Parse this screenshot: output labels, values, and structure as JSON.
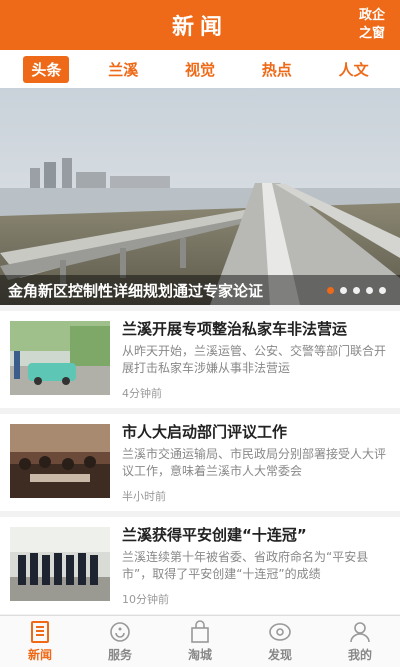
{
  "header": {
    "title": "新闻",
    "right_label": "政企之窗"
  },
  "tabs": [
    {
      "label": "头条",
      "active": true
    },
    {
      "label": "兰溪",
      "active": false
    },
    {
      "label": "视觉",
      "active": false
    },
    {
      "label": "热点",
      "active": false
    },
    {
      "label": "人文",
      "active": false
    }
  ],
  "banner": {
    "caption": "金角新区控制性详细规划通过专家论证",
    "dots": 5,
    "active_dot": 0
  },
  "news": [
    {
      "title": "兰溪开展专项整治私家车非法营运",
      "summary": "从昨天开始，兰溪运管、公安、交警等部门联合开展打击私家车涉嫌从事非法营运",
      "time": "4分钟前"
    },
    {
      "title": "市人大启动部门评议工作",
      "summary": "兰溪市交通运输局、市民政局分别部署接受人大评议工作，意味着兰溪市人大常委会",
      "time": "半小时前"
    },
    {
      "title": "兰溪获得平安创建“十连冠”",
      "summary": "兰溪连续第十年被省委、省政府命名为“平安县市”，取得了平安创建“十连冠”的成绩",
      "time": "10分钟前"
    }
  ],
  "bottom_nav": [
    {
      "label": "新闻",
      "icon": "news-icon",
      "active": true
    },
    {
      "label": "服务",
      "icon": "service-icon",
      "active": false
    },
    {
      "label": "淘城",
      "icon": "shopping-bag-icon",
      "active": false
    },
    {
      "label": "发现",
      "icon": "discover-icon",
      "active": false
    },
    {
      "label": "我的",
      "icon": "user-icon",
      "active": false
    }
  ],
  "colors": {
    "accent": "#ee6a18",
    "background": "#f2f2f2"
  }
}
